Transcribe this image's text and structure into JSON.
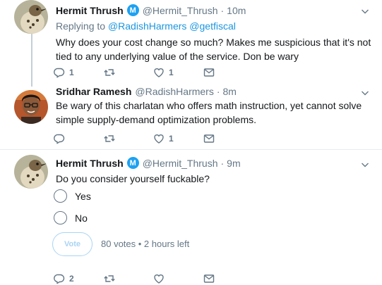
{
  "colors": {
    "accent": "#1da1f2",
    "link": "#1b95e0",
    "muted": "#657786",
    "thread_line": "#c4cfd6"
  },
  "tweets": [
    {
      "name": "Hermit Thrush",
      "verified_mark": "M",
      "handle": "@Hermit_Thrush",
      "separator": "·",
      "time": "10m",
      "replying_prefix": "Replying to",
      "replying_to": "@RadishHarmers @getfiscal",
      "text": "Why does your cost change so much? Makes me suspicious that it's not tied to any underlying value of the service. Don be wary",
      "reply_count": "1",
      "retweet_count": "",
      "like_count": "1"
    },
    {
      "name": "Sridhar Ramesh",
      "handle": "@RadishHarmers",
      "separator": "·",
      "time": "8m",
      "text": "Be wary of this charlatan who offers math instruction, yet cannot solve simple supply-demand optimization problems.",
      "reply_count": "",
      "retweet_count": "",
      "like_count": "1"
    },
    {
      "name": "Hermit Thrush",
      "verified_mark": "M",
      "handle": "@Hermit_Thrush",
      "separator": "·",
      "time": "9m",
      "text": "Do you consider yourself fuckable?",
      "poll": {
        "options": [
          "Yes",
          "No"
        ],
        "vote_label": "Vote",
        "meta": "80 votes • 2 hours left"
      },
      "reply_count": "2",
      "retweet_count": "",
      "like_count": ""
    }
  ],
  "icons": {
    "reply": "reply-icon",
    "retweet": "retweet-icon",
    "like": "heart-icon",
    "dm": "envelope-icon",
    "caret": "chevron-down-icon",
    "verified": "verified-badge-icon"
  }
}
